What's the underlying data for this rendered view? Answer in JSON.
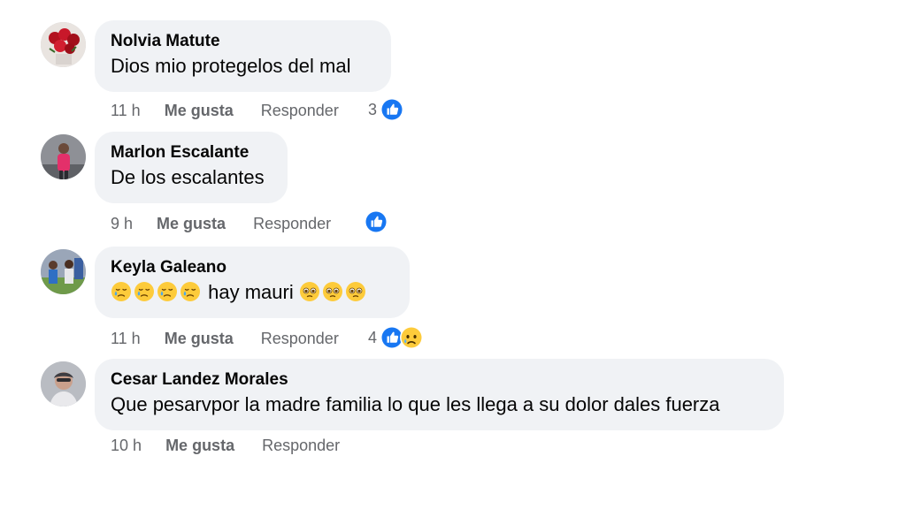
{
  "comments": [
    {
      "author": "Nolvia Matute",
      "text": "Dios mio protegelos del mal",
      "time": "11 h",
      "like_label": "Me gusta",
      "reply_label": "Responder",
      "reaction_count": "3",
      "reactions": [
        "like-icon"
      ]
    },
    {
      "author": "Marlon Escalante",
      "text": "De los escalantes",
      "time": "9 h",
      "like_label": "Me gusta",
      "reply_label": "Responder",
      "reaction_count": "",
      "reactions": [
        "like-icon"
      ]
    },
    {
      "author": "Keyla Galeano",
      "text_before": "",
      "text": "hay mauri",
      "leading_emojis": [
        "crying-face-emoji",
        "crying-face-emoji",
        "crying-face-emoji",
        "crying-face-emoji"
      ],
      "trailing_emojis": [
        "pleading-face-emoji",
        "pleading-face-emoji",
        "pleading-face-emoji"
      ],
      "time": "11 h",
      "like_label": "Me gusta",
      "reply_label": "Responder",
      "reaction_count": "4",
      "reactions": [
        "like-icon",
        "sad-reaction-icon"
      ]
    },
    {
      "author": "Cesar Landez Morales",
      "text": "Que pesarvpor la madre familia lo que les llega a su dolor dales fuerza",
      "time": "10 h",
      "like_label": "Me gusta",
      "reply_label": "Responder",
      "reaction_count": "",
      "reactions": []
    }
  ],
  "colors": {
    "bubble": "#f0f2f5",
    "secondary_text": "#65676b",
    "like_blue": "#1877f2",
    "emoji_yellow": "#fdcb3b"
  }
}
